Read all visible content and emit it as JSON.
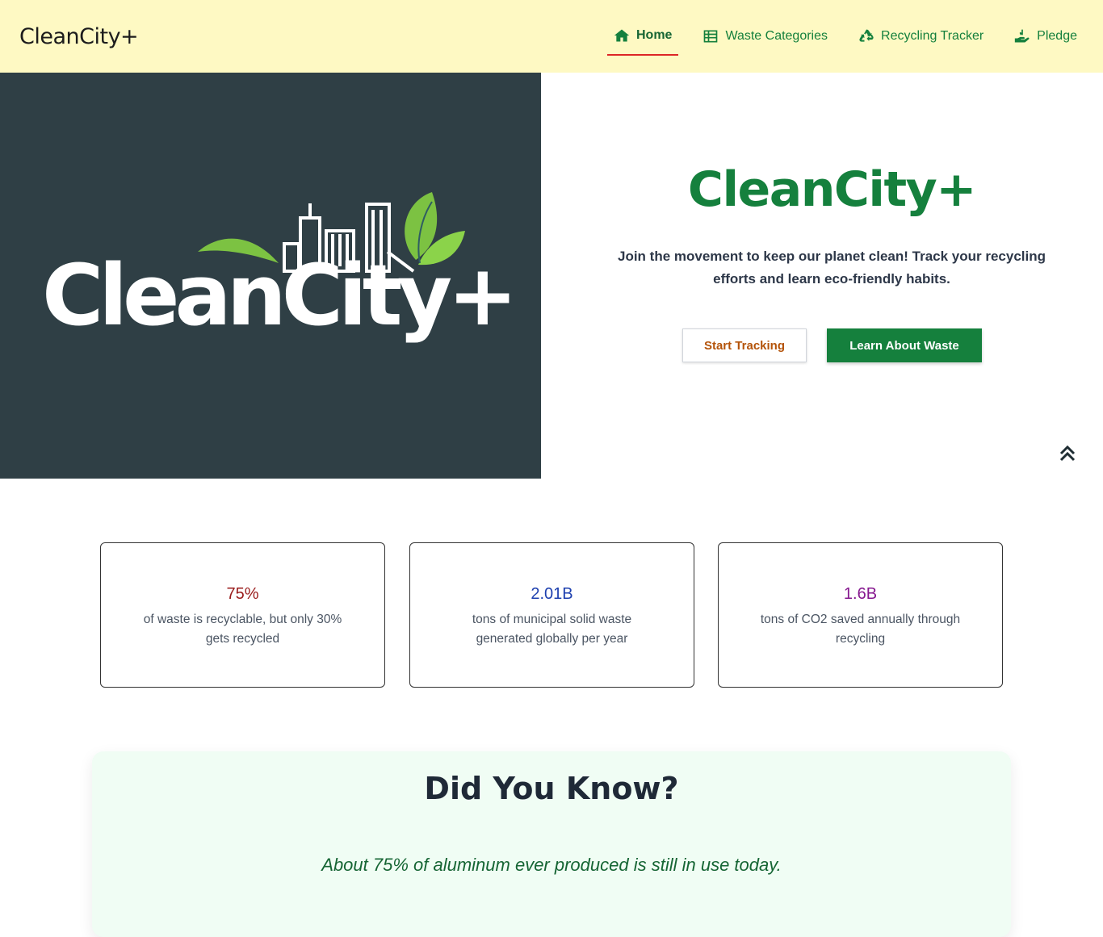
{
  "header": {
    "brand": "CleanCity+",
    "nav": [
      {
        "label": "Home",
        "icon": "home-icon",
        "active": true
      },
      {
        "label": "Waste Categories",
        "icon": "list-icon",
        "active": false
      },
      {
        "label": "Recycling Tracker",
        "icon": "recycle-icon",
        "active": false
      },
      {
        "label": "Pledge",
        "icon": "hand-holding-icon",
        "active": false
      }
    ]
  },
  "hero": {
    "logo_text": "CleanCity+",
    "title": "CleanCity+",
    "subtitle": "Join the movement to keep our planet clean! Track your recycling efforts and learn eco-friendly habits.",
    "primary_button": "Start Tracking",
    "secondary_button": "Learn About Waste",
    "scroll_icon": "chevron-double-up-icon"
  },
  "stats": [
    {
      "value": "75%",
      "desc": "of waste is recyclable, but only 30% gets recycled",
      "color": "#991b1b"
    },
    {
      "value": "2.01B",
      "desc": "tons of municipal solid waste generated globally per year",
      "color": "#1e40af"
    },
    {
      "value": "1.6B",
      "desc": "tons of CO2 saved annually through recycling",
      "color": "#86198f"
    }
  ],
  "did_you_know": {
    "title": "Did You Know?",
    "fact": "About 75% of aluminum ever produced is still in use today."
  },
  "colors": {
    "header_bg": "#fef9c3",
    "brand_green": "#15803d",
    "hero_image_bg": "#2f3f45",
    "dyk_bg": "#f0fdf4"
  }
}
